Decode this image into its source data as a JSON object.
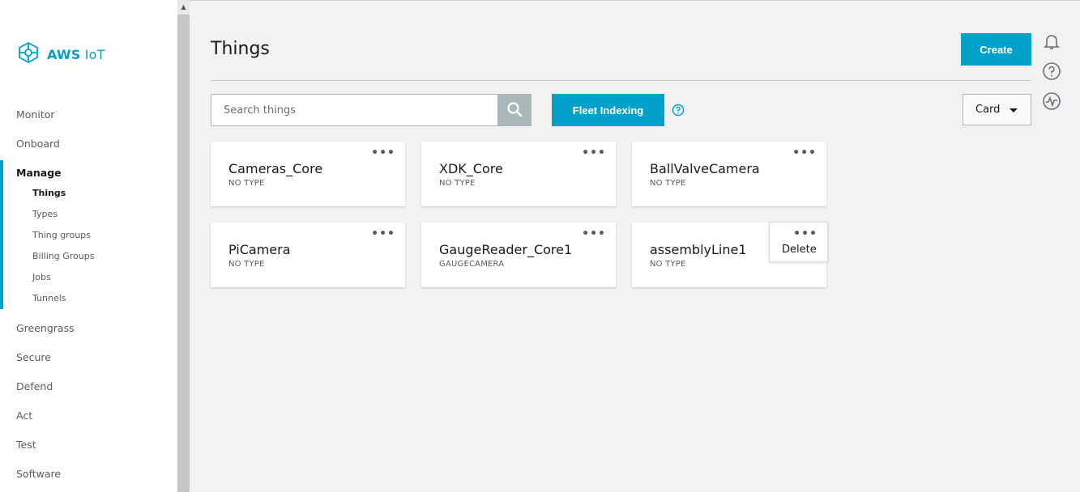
{
  "brand": {
    "name_bold": "AWS",
    "name_rest": "IoT"
  },
  "sidebar": {
    "items": [
      {
        "label": "Monitor"
      },
      {
        "label": "Onboard"
      },
      {
        "label": "Manage"
      },
      {
        "label": "Greengrass"
      },
      {
        "label": "Secure"
      },
      {
        "label": "Defend"
      },
      {
        "label": "Act"
      },
      {
        "label": "Test"
      },
      {
        "label": "Software"
      }
    ],
    "manage_sub": [
      {
        "label": "Things"
      },
      {
        "label": "Types"
      },
      {
        "label": "Thing groups"
      },
      {
        "label": "Billing Groups"
      },
      {
        "label": "Jobs"
      },
      {
        "label": "Tunnels"
      }
    ]
  },
  "header": {
    "title": "Things",
    "create_label": "Create"
  },
  "search": {
    "placeholder": "Search things"
  },
  "toolbar": {
    "fleet_label": "Fleet Indexing",
    "view_value": "Card"
  },
  "cards": [
    {
      "name": "Cameras_Core",
      "type": "NO TYPE"
    },
    {
      "name": "XDK_Core",
      "type": "NO TYPE"
    },
    {
      "name": "BallValveCamera",
      "type": "NO TYPE"
    },
    {
      "name": "PiCamera",
      "type": "NO TYPE"
    },
    {
      "name": "GaugeReader_Core1",
      "type": "GAUGECAMERA"
    },
    {
      "name": "assemblyLine1",
      "type": "NO TYPE"
    }
  ],
  "card_menu": {
    "dots": "•••",
    "delete_label": "Delete"
  },
  "icons": {
    "logo": "aws-iot-logo-icon",
    "search": "search-icon",
    "help": "help-icon",
    "notifications": "bell-icon",
    "activity": "activity-icon"
  },
  "colors": {
    "accent": "#00a1c9",
    "search_button": "#aab7b8"
  }
}
